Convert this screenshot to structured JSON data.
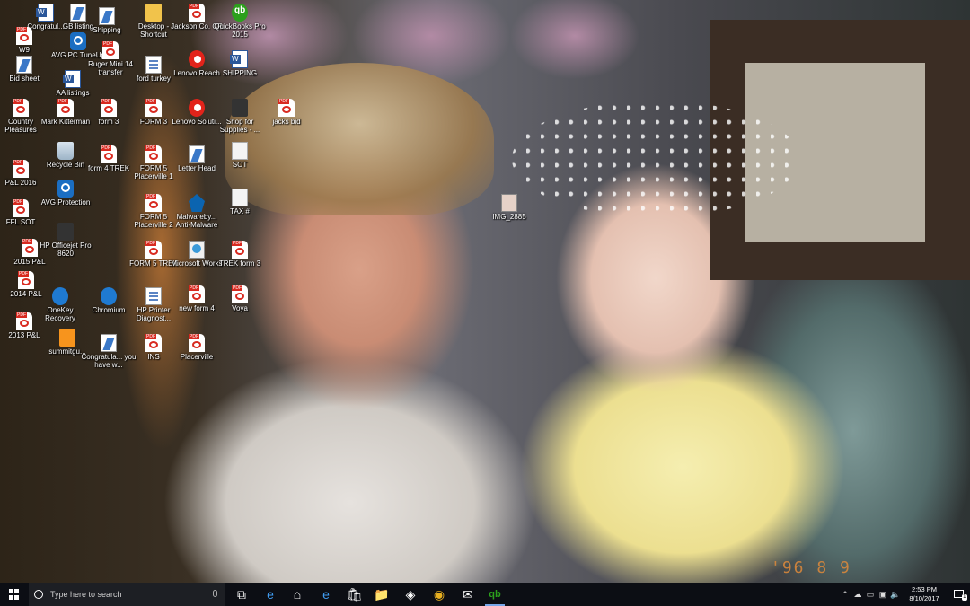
{
  "desktop_icons": [
    {
      "label": "Congratul...",
      "kind": "word"
    },
    {
      "label": "GB listing",
      "kind": "shortcut"
    },
    {
      "label": "Shipping",
      "kind": "shortcut"
    },
    {
      "label": "Desktop - Shortcut",
      "kind": "folder"
    },
    {
      "label": "Jackson Co. CR",
      "kind": "pdf"
    },
    {
      "label": "QuickBooks Pro 2015",
      "kind": "qb"
    },
    {
      "label": "W9",
      "kind": "pdf"
    },
    {
      "label": "AVG PC TuneUp",
      "kind": "avg"
    },
    {
      "label": "Ruger Mini 14 transfer",
      "kind": "pdf"
    },
    {
      "label": "ford turkey",
      "kind": "doc"
    },
    {
      "label": "Lenovo Reach",
      "kind": "lenovo"
    },
    {
      "label": "SHIPPING",
      "kind": "word"
    },
    {
      "label": "Bid sheet",
      "kind": "shortcut"
    },
    {
      "label": "AA listings",
      "kind": "word"
    },
    {
      "label": "Country Pleasures",
      "kind": "pdf"
    },
    {
      "label": "Mark Kitterman",
      "kind": "pdf"
    },
    {
      "label": "form 3",
      "kind": "pdf"
    },
    {
      "label": "FORM 3",
      "kind": "pdf"
    },
    {
      "label": "Lenovo Soluti...",
      "kind": "lenovo"
    },
    {
      "label": "Shop for Supplies - ...",
      "kind": "printer"
    },
    {
      "label": "jacks bid",
      "kind": "pdf"
    },
    {
      "label": "P&L 2016",
      "kind": "pdf"
    },
    {
      "label": "Recycle Bin",
      "kind": "bin"
    },
    {
      "label": "form 4 TREK",
      "kind": "pdf"
    },
    {
      "label": "FORM 5 Placerville 1",
      "kind": "pdf"
    },
    {
      "label": "Letter Head",
      "kind": "shortcut"
    },
    {
      "label": "SOT",
      "kind": "white"
    },
    {
      "label": "AVG Protection",
      "kind": "avg"
    },
    {
      "label": "IMG_2885",
      "kind": "img"
    },
    {
      "label": "FFL SOT",
      "kind": "pdf"
    },
    {
      "label": "FORM 5 Placerville 2",
      "kind": "pdf"
    },
    {
      "label": "Malwareby... Anti-Malware",
      "kind": "mb"
    },
    {
      "label": "TAX #",
      "kind": "white"
    },
    {
      "label": "HP Officejet Pro 8620",
      "kind": "printer"
    },
    {
      "label": "2015 P&L",
      "kind": "pdf"
    },
    {
      "label": "FORM 5 TREK",
      "kind": "pdf"
    },
    {
      "label": "Microsoft Works",
      "kind": "works"
    },
    {
      "label": "TREK form 3",
      "kind": "pdf"
    },
    {
      "label": "2014 P&L",
      "kind": "pdf"
    },
    {
      "label": "OneKey Recovery",
      "kind": "blue"
    },
    {
      "label": "Chromium",
      "kind": "blue"
    },
    {
      "label": "HP Printer Diagnost...",
      "kind": "doc"
    },
    {
      "label": "new form 4",
      "kind": "pdf"
    },
    {
      "label": "Voya",
      "kind": "pdf"
    },
    {
      "label": "2013 P&L",
      "kind": "pdf"
    },
    {
      "label": "summitgu...",
      "kind": "orange"
    },
    {
      "label": "Congratula... you have w...",
      "kind": "shortcut"
    },
    {
      "label": "INS",
      "kind": "pdf"
    },
    {
      "label": "Placerville",
      "kind": "pdf"
    }
  ],
  "photo": {
    "date_stamp": "'96 8 9"
  },
  "taskbar": {
    "search_placeholder": "Type here to search",
    "apps": [
      {
        "name": "task-view-icon",
        "glyph": "⧉"
      },
      {
        "name": "edge-icon",
        "glyph": "e"
      },
      {
        "name": "home-icon",
        "glyph": "⌂"
      },
      {
        "name": "ie-icon",
        "glyph": "e"
      },
      {
        "name": "store-icon",
        "glyph": "🛍"
      },
      {
        "name": "file-explorer-icon",
        "glyph": "📁"
      },
      {
        "name": "safari-icon",
        "glyph": "◈"
      },
      {
        "name": "chrome-icon",
        "glyph": "◉"
      },
      {
        "name": "mail-icon",
        "glyph": "✉"
      },
      {
        "name": "quickbooks-icon",
        "glyph": "qb"
      }
    ],
    "clock_time": "2:53 PM",
    "clock_date": "8/10/2017",
    "notification_count": "1"
  },
  "colors": {
    "taskbar_bg": "#0c0e14",
    "pdf_red": "#d82a20",
    "word_blue": "#2b579a",
    "qb_green": "#2ca01c",
    "date_stamp": "#e08a3a"
  }
}
